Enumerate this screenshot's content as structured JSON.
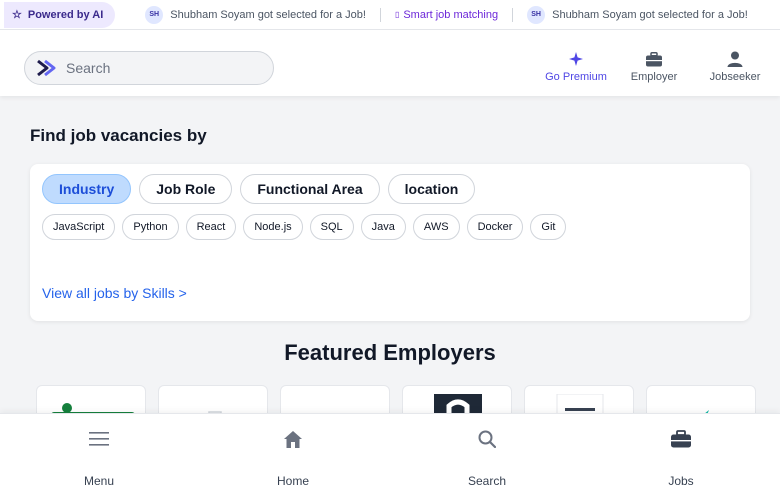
{
  "ticker": {
    "powered_label": "Powered by AI",
    "items": [
      {
        "avatar": "SH",
        "text": "Shubham Soyam got selected for a Job!"
      },
      {
        "text": "Smart job matching"
      },
      {
        "avatar": "SH",
        "text": "Shubham Soyam got selected for a Job!"
      }
    ]
  },
  "header": {
    "search_placeholder": "Search",
    "nav": {
      "premium": "Go Premium",
      "employer": "Employer",
      "jobseeker": "Jobseeker"
    }
  },
  "find_jobs": {
    "title": "Find job vacancies by",
    "tabs": [
      "Industry",
      "Job Role",
      "Functional Area",
      "location"
    ],
    "active_tab": "Industry",
    "chips": [
      "JavaScript",
      "Python",
      "React",
      "Node.js",
      "SQL",
      "Java",
      "AWS",
      "Docker",
      "Git"
    ],
    "view_all": "View all jobs by Skills >"
  },
  "featured": {
    "title": "Featured Employers"
  },
  "bottom_nav": {
    "menu": "Menu",
    "home": "Home",
    "search": "Search",
    "jobs": "Jobs"
  },
  "colors": {
    "accent": "#4f46e5",
    "link": "#2563eb",
    "active_tab_bg": "#bfdbfe",
    "powered_bg": "#ede9fe"
  },
  "icons": {
    "powered": "star-icon",
    "premium": "sparkle-icon",
    "employer": "briefcase-icon",
    "jobseeker": "user-icon",
    "menu": "hamburger-icon",
    "home": "home-icon",
    "search": "search-icon",
    "jobs": "briefcase-icon"
  }
}
